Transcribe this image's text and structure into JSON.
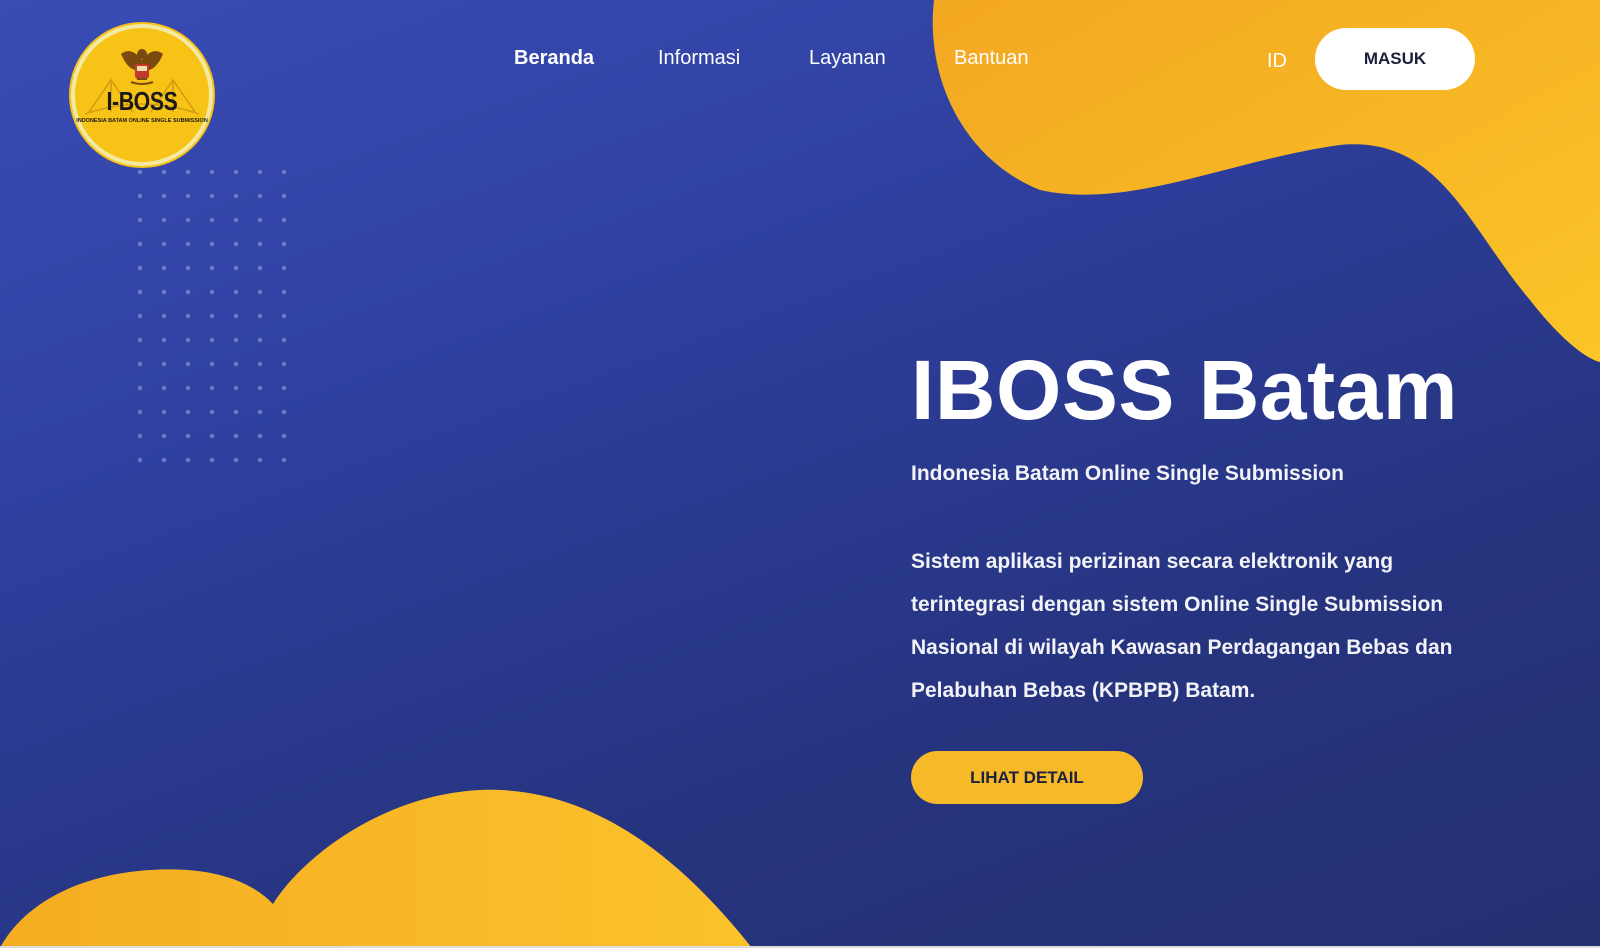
{
  "logo": {
    "title": "I-BOSS",
    "subtitle": "INDONESIA BATAM ONLINE SINGLE SUBMISSION"
  },
  "nav": {
    "items": [
      {
        "label": "Beranda",
        "active": true
      },
      {
        "label": "Informasi",
        "active": false
      },
      {
        "label": "Layanan",
        "active": false
      },
      {
        "label": "Bantuan",
        "active": false
      }
    ],
    "language": "ID",
    "login_label": "MASUK"
  },
  "hero": {
    "title": "IBOSS Batam",
    "subtitle": "Indonesia Batam Online Single Submission",
    "description": "Sistem aplikasi perizinan secara elektronik yang terintegrasi dengan sistem Online Single Submission Nasional di wilayah Kawasan Perdagangan Bebas dan Pelabuhan Bebas (KPBPB) Batam.",
    "button_label": "LIHAT DETAIL"
  },
  "colors": {
    "background": "#2e3f9e",
    "accent_yellow": "#f6b928",
    "text": "#ffffff"
  }
}
